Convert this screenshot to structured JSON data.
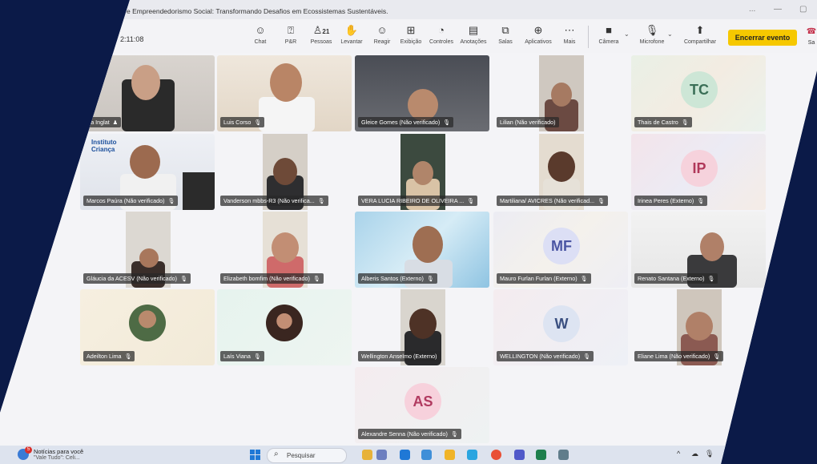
{
  "window": {
    "title": "e Empreendedorismo Social: Transformando Desafios em Ecossistemas Sustentáveis.",
    "controls": [
      "...",
      "—",
      "▢"
    ]
  },
  "meeting": {
    "elapsed_time": "2:11:08",
    "participant_count": "21"
  },
  "toolbar": {
    "items": [
      {
        "label": "Chat",
        "icon": "chat-icon",
        "glyph": "☺"
      },
      {
        "label": "P&R",
        "icon": "qa-icon",
        "glyph": "⍰"
      },
      {
        "label": "Pessoas",
        "icon": "people-icon",
        "glyph": "♙"
      },
      {
        "label": "Levantar",
        "icon": "raise-hand-icon",
        "glyph": "✋"
      },
      {
        "label": "Reagir",
        "icon": "react-icon",
        "glyph": "☺"
      },
      {
        "label": "Exibição",
        "icon": "view-icon",
        "glyph": "⊞"
      },
      {
        "label": "Controles",
        "icon": "controls-icon",
        "glyph": "◔"
      },
      {
        "label": "Anotações",
        "icon": "notes-icon",
        "glyph": "▤"
      },
      {
        "label": "Salas",
        "icon": "rooms-icon",
        "glyph": "⧉"
      },
      {
        "label": "Aplicativos",
        "icon": "apps-icon",
        "glyph": "⊕"
      },
      {
        "label": "Mais",
        "icon": "more-icon",
        "glyph": "⋯"
      },
      {
        "label": "Câmera",
        "icon": "camera-icon",
        "glyph": "■"
      },
      {
        "label": "Microfone",
        "icon": "microphone-icon",
        "glyph": "🎙"
      },
      {
        "label": "Compartilhar",
        "icon": "share-icon",
        "glyph": "⬆"
      }
    ],
    "end_event": "Encerrar evento",
    "leave_short": "Sa"
  },
  "participants": [
    {
      "name": "ica Inglat",
      "kind": "video"
    },
    {
      "name": "Luis Corso",
      "kind": "video"
    },
    {
      "name": "Gleice Gomes (Não verificado)",
      "kind": "video"
    },
    {
      "name": "Lilian (Não verificado)",
      "kind": "video"
    },
    {
      "name": "Thais de Castro",
      "kind": "initials",
      "initials": "TC"
    },
    {
      "name": "Marcos Paúra (Não verificado)",
      "kind": "video",
      "banner": "Instituto Criança"
    },
    {
      "name": "Vanderson mbbs-R3 (Não verifica...",
      "kind": "video"
    },
    {
      "name": "VERA LUCIA RIBEIRO DE OLIVEIRA ...",
      "kind": "video"
    },
    {
      "name": "Martiliana/ AVICRES (Não verificad...",
      "kind": "video"
    },
    {
      "name": "Irinea Peres (Externo)",
      "kind": "initials",
      "initials": "IP"
    },
    {
      "name": "Gláucia da ACESV (Não verificado)",
      "kind": "video"
    },
    {
      "name": "Elizabeth bomfim (Não verificado)",
      "kind": "video"
    },
    {
      "name": "Alberis Santos (Externo)",
      "kind": "video"
    },
    {
      "name": "Mauro Furlan Furlan (Externo)",
      "kind": "initials",
      "initials": "MF"
    },
    {
      "name": "Renato Santana (Externo)",
      "kind": "video"
    },
    {
      "name": "Adeilton Lima",
      "kind": "photo"
    },
    {
      "name": "Laís Viana",
      "kind": "photo"
    },
    {
      "name": "Wellington Anselmo (Externo)",
      "kind": "video"
    },
    {
      "name": "WELLINGTON (Não verificado)",
      "kind": "initials",
      "initials": "W"
    },
    {
      "name": "Eliane Lima (Não verificado)",
      "kind": "video"
    },
    {
      "name": "Alexandre Senna (Não verificado)",
      "kind": "initials",
      "initials": "AS"
    }
  ],
  "taskbar": {
    "news_title": "Notícias para você",
    "news_subtitle": "\"Vale Tudo\": Celi...",
    "news_badge": "5",
    "search_placeholder": "Pesquisar",
    "search_glyph": "⌕",
    "tray": [
      "^",
      "☁",
      "🎙"
    ]
  },
  "colors": {
    "end_button": "#f6c800",
    "frame_background": "#0b1a48",
    "taskbar": "#dde3ee"
  }
}
